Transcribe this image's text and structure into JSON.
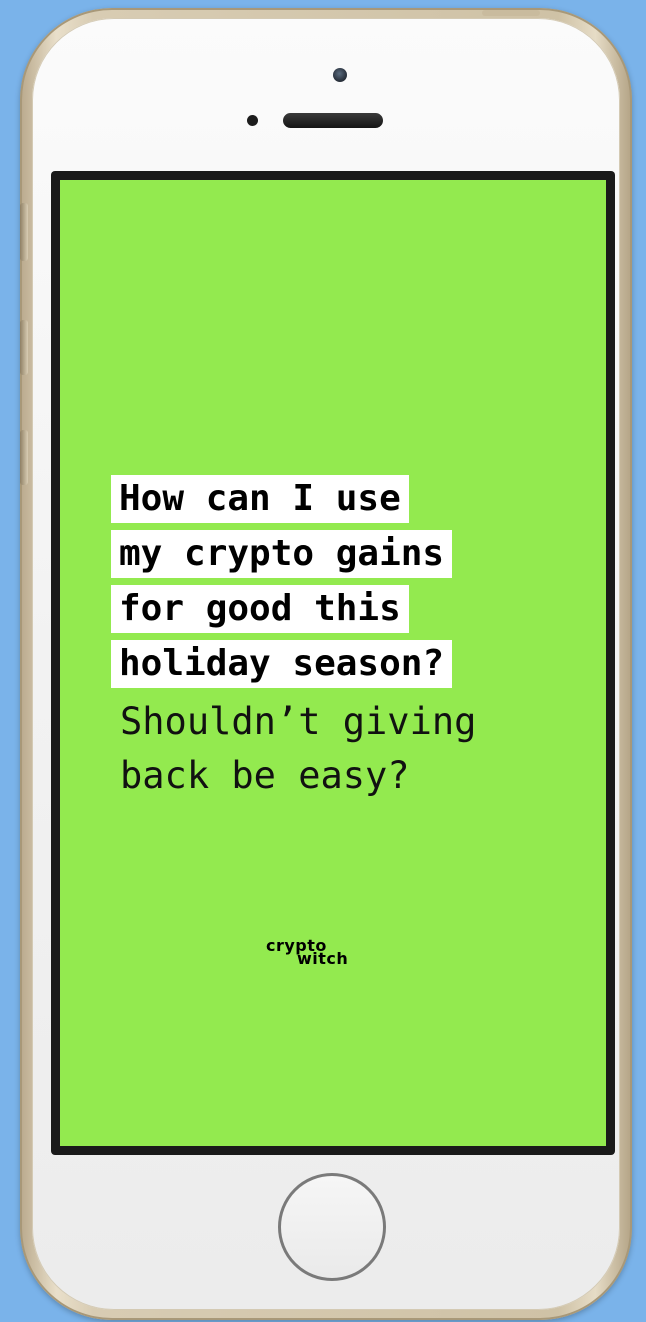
{
  "device": {
    "type": "iPhone",
    "body_color": "#d8ccb3",
    "background_color": "#7ab3ea"
  },
  "screen": {
    "background_color": "#93ea4f",
    "headline_lines": [
      "How can I use",
      "my crypto gains",
      "for good this",
      "holiday season?"
    ],
    "subtext_lines": [
      "Shouldn’t giving",
      "back be easy?"
    ],
    "logo": {
      "word1": "crypto",
      "word2": "witch"
    }
  },
  "icons": {
    "camera": "front-camera-icon",
    "speaker": "earpiece-speaker-icon",
    "home": "home-button-icon"
  }
}
